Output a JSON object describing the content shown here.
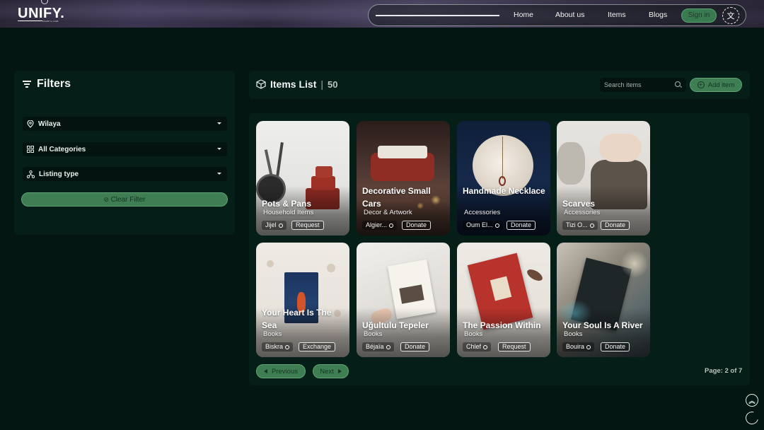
{
  "header": {
    "logo": "UNIFY.",
    "logo_tagline": "SHARE & CARE",
    "nav": [
      "Home",
      "About us",
      "Items",
      "Blogs"
    ],
    "sign_in": "Sign in",
    "language_icon": "translate-icon"
  },
  "filters": {
    "title": "Filters",
    "wilaya": "Wilaya",
    "categories": "All Categories",
    "listing_type": "Listing type",
    "clear": "Clear Filter"
  },
  "items_list": {
    "title": "Items List",
    "count": "50",
    "search_placeholder": "Search items",
    "add_item": "Add item"
  },
  "items": [
    {
      "title": "Pots & Pans",
      "category": "Household Items",
      "location": "Jijel",
      "type": "Request"
    },
    {
      "title": "Decorative Small Cars",
      "category": "Decor & Artwork",
      "location": "Algier...",
      "type": "Donate"
    },
    {
      "title": "Handmade Necklace",
      "category": "Accessories",
      "location": "Oum El...",
      "type": "Donate"
    },
    {
      "title": "Scarves",
      "category": "Accessories",
      "location": "Tizi O...",
      "type": "Donate"
    },
    {
      "title": "Your Heart Is The Sea",
      "category": "Books",
      "location": "Biskra",
      "type": "Exchange"
    },
    {
      "title": "Uğultulu Tepeler",
      "category": "Books",
      "location": "Béjaïa",
      "type": "Donate"
    },
    {
      "title": "The Passion Within",
      "category": "Books",
      "location": "Chlef",
      "type": "Request"
    },
    {
      "title": "Your Soul Is A River",
      "category": "Books",
      "location": "Bouira",
      "type": "Donate"
    }
  ],
  "pagination": {
    "previous": "Previous",
    "next": "Next",
    "page_info": "Page: 2 of 7"
  },
  "colors": {
    "background": "#041612",
    "panel": "#061e18",
    "accent": "#3e7e52"
  }
}
